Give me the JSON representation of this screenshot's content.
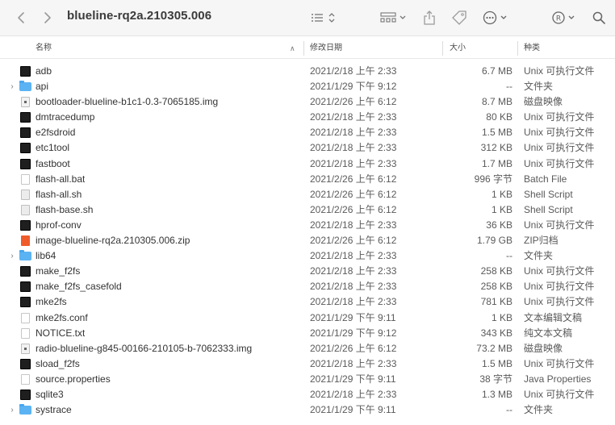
{
  "window": {
    "title": "blueline-rq2a.210305.006"
  },
  "columns": {
    "name": "名称",
    "date": "修改日期",
    "size": "大小",
    "kind": "种类"
  },
  "files": [
    {
      "name": "adb",
      "date": "2021/2/18 上午 2:33",
      "size": "6.7 MB",
      "kind": "Unix 可执行文件",
      "icon": "exec-icon",
      "disclosure": ""
    },
    {
      "name": "api",
      "date": "2021/1/29 下午 9:12",
      "size": "--",
      "kind": "文件夹",
      "icon": "folder-icon",
      "disclosure": "›"
    },
    {
      "name": "bootloader-blueline-b1c1-0.3-7065185.img",
      "date": "2021/2/26 上午 6:12",
      "size": "8.7 MB",
      "kind": "磁盘映像",
      "icon": "disk-image-icon",
      "disclosure": ""
    },
    {
      "name": "dmtracedump",
      "date": "2021/2/18 上午 2:33",
      "size": "80 KB",
      "kind": "Unix 可执行文件",
      "icon": "exec-icon",
      "disclosure": ""
    },
    {
      "name": "e2fsdroid",
      "date": "2021/2/18 上午 2:33",
      "size": "1.5 MB",
      "kind": "Unix 可执行文件",
      "icon": "exec-icon",
      "disclosure": ""
    },
    {
      "name": "etc1tool",
      "date": "2021/2/18 上午 2:33",
      "size": "312 KB",
      "kind": "Unix 可执行文件",
      "icon": "exec-icon",
      "disclosure": ""
    },
    {
      "name": "fastboot",
      "date": "2021/2/18 上午 2:33",
      "size": "1.7 MB",
      "kind": "Unix 可执行文件",
      "icon": "exec-icon",
      "disclosure": ""
    },
    {
      "name": "flash-all.bat",
      "date": "2021/2/26 上午 6:12",
      "size": "996 字节",
      "kind": "Batch File",
      "icon": "document-icon",
      "disclosure": ""
    },
    {
      "name": "flash-all.sh",
      "date": "2021/2/26 上午 6:12",
      "size": "1 KB",
      "kind": "Shell Script",
      "icon": "script-icon",
      "disclosure": ""
    },
    {
      "name": "flash-base.sh",
      "date": "2021/2/26 上午 6:12",
      "size": "1 KB",
      "kind": "Shell Script",
      "icon": "script-icon",
      "disclosure": ""
    },
    {
      "name": "hprof-conv",
      "date": "2021/2/18 上午 2:33",
      "size": "36 KB",
      "kind": "Unix 可执行文件",
      "icon": "exec-icon",
      "disclosure": ""
    },
    {
      "name": "image-blueline-rq2a.210305.006.zip",
      "date": "2021/2/26 上午 6:12",
      "size": "1.79 GB",
      "kind": "ZIP归档",
      "icon": "zip-icon",
      "disclosure": ""
    },
    {
      "name": "lib64",
      "date": "2021/2/18 上午 2:33",
      "size": "--",
      "kind": "文件夹",
      "icon": "folder-icon",
      "disclosure": "›"
    },
    {
      "name": "make_f2fs",
      "date": "2021/2/18 上午 2:33",
      "size": "258 KB",
      "kind": "Unix 可执行文件",
      "icon": "exec-icon",
      "disclosure": ""
    },
    {
      "name": "make_f2fs_casefold",
      "date": "2021/2/18 上午 2:33",
      "size": "258 KB",
      "kind": "Unix 可执行文件",
      "icon": "exec-icon",
      "disclosure": ""
    },
    {
      "name": "mke2fs",
      "date": "2021/2/18 上午 2:33",
      "size": "781 KB",
      "kind": "Unix 可执行文件",
      "icon": "exec-icon",
      "disclosure": ""
    },
    {
      "name": "mke2fs.conf",
      "date": "2021/1/29 下午 9:11",
      "size": "1 KB",
      "kind": "文本编辑文稿",
      "icon": "document-icon",
      "disclosure": ""
    },
    {
      "name": "NOTICE.txt",
      "date": "2021/1/29 下午 9:12",
      "size": "343 KB",
      "kind": "纯文本文稿",
      "icon": "document-icon",
      "disclosure": ""
    },
    {
      "name": "radio-blueline-g845-00166-210105-b-7062333.img",
      "date": "2021/2/26 上午 6:12",
      "size": "73.2 MB",
      "kind": "磁盘映像",
      "icon": "disk-image-icon",
      "disclosure": ""
    },
    {
      "name": "sload_f2fs",
      "date": "2021/2/18 上午 2:33",
      "size": "1.5 MB",
      "kind": "Unix 可执行文件",
      "icon": "exec-icon",
      "disclosure": ""
    },
    {
      "name": "source.properties",
      "date": "2021/1/29 下午 9:11",
      "size": "38 字节",
      "kind": "Java Properties",
      "icon": "document-icon",
      "disclosure": ""
    },
    {
      "name": "sqlite3",
      "date": "2021/2/18 上午 2:33",
      "size": "1.3 MB",
      "kind": "Unix 可执行文件",
      "icon": "exec-icon",
      "disclosure": ""
    },
    {
      "name": "systrace",
      "date": "2021/1/29 下午 9:11",
      "size": "--",
      "kind": "文件夹",
      "icon": "folder-icon",
      "disclosure": "›"
    }
  ]
}
